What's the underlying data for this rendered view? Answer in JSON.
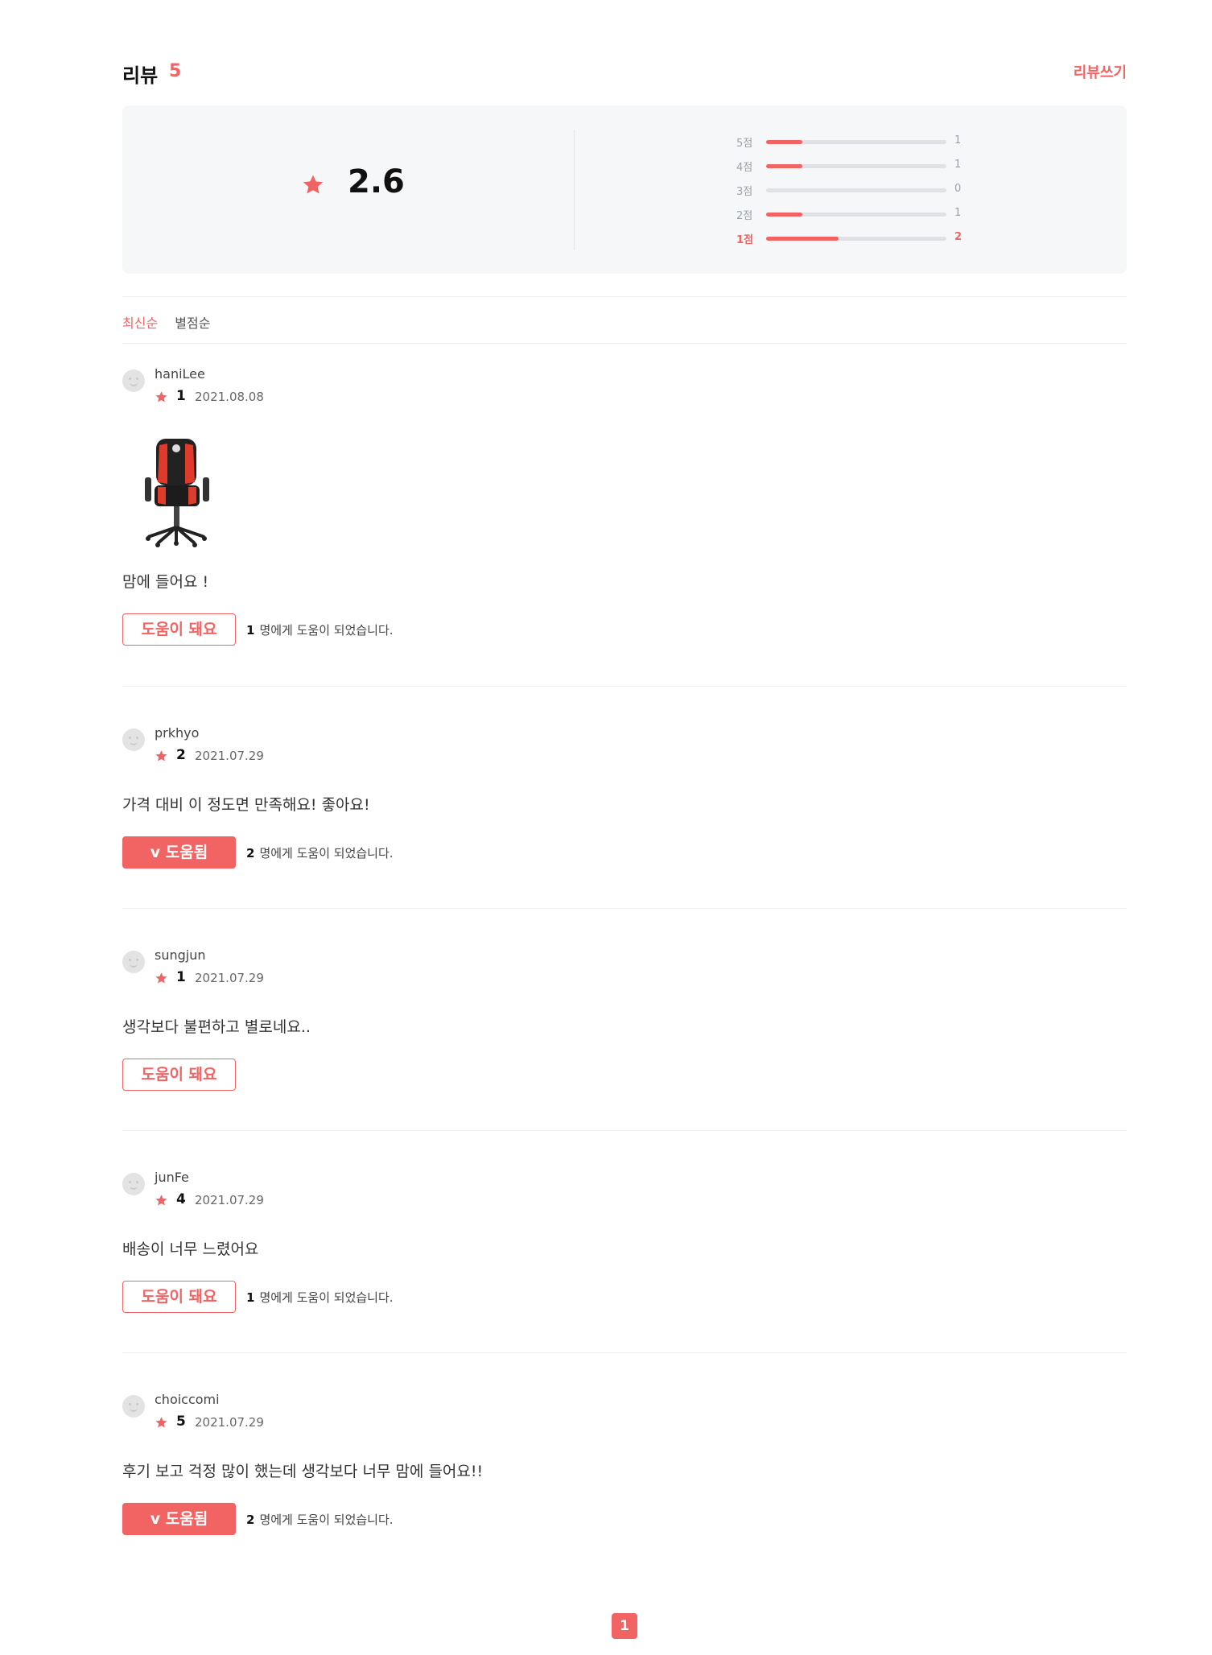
{
  "header": {
    "title": "리뷰",
    "count": "5",
    "write_label": "리뷰쓰기"
  },
  "summary": {
    "average": "2.6",
    "distribution": [
      {
        "label": "5점",
        "count": "1",
        "fraction": 0.2
      },
      {
        "label": "4점",
        "count": "1",
        "fraction": 0.2
      },
      {
        "label": "3점",
        "count": "0",
        "fraction": 0.0
      },
      {
        "label": "2점",
        "count": "1",
        "fraction": 0.2
      },
      {
        "label": "1점",
        "count": "2",
        "fraction": 0.4
      }
    ]
  },
  "sort": {
    "latest": "최신순",
    "rating": "별점순",
    "selected": "최신순"
  },
  "reviews": [
    {
      "user": "haniLee",
      "score": "1",
      "date": "2021.08.08",
      "text": "맘에 들어요 !",
      "has_photo": true,
      "button": "도움이 돼요",
      "button_state": "default",
      "helpful_count": "1",
      "helpful_text": "명에게 도움이 되었습니다."
    },
    {
      "user": "prkhyo",
      "score": "2",
      "date": "2021.07.29",
      "text": "가격 대비 이 정도면 만족해요! 좋아요!",
      "button": "v 도움됨",
      "button_state": "active",
      "helpful_count": "2",
      "helpful_text": "명에게 도움이 되었습니다."
    },
    {
      "user": "sungjun",
      "score": "1",
      "date": "2021.07.29",
      "text": "생각보다 불편하고 별로네요..",
      "button": "도움이 돼요",
      "button_state": "default"
    },
    {
      "user": "junFe",
      "score": "4",
      "date": "2021.07.29",
      "text": "배송이 너무 느렸어요",
      "button": "도움이 돼요",
      "button_state": "default",
      "helpful_count": "1",
      "helpful_text": "명에게 도움이 되었습니다."
    },
    {
      "user": "choiccomi",
      "score": "5",
      "date": "2021.07.29",
      "text": "후기 보고 걱정 많이 했는데 생각보다 너무 맘에 들어요!!",
      "button": "v 도움됨",
      "button_state": "active",
      "helpful_count": "2",
      "helpful_text": "명에게 도움이 되었습니다."
    }
  ],
  "pagination": {
    "current": "1"
  },
  "colors": {
    "accent": "#f26363",
    "track": "#dfe1e5",
    "panel": "#f6f7f9"
  },
  "icons": {
    "rating": "star-icon",
    "avatar": "smiley-icon"
  }
}
